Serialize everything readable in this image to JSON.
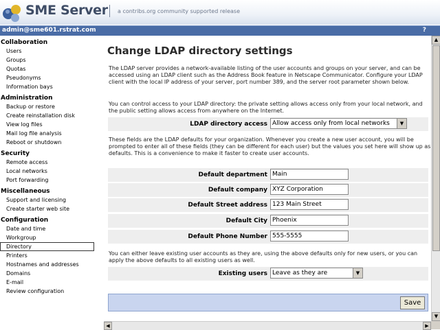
{
  "header": {
    "brand": "SME Server",
    "tagline": "a contribs.org community supported release"
  },
  "userbar": {
    "user": "admin@sme601.rstrat.com",
    "help": "?"
  },
  "sidebar": {
    "sections": [
      {
        "title": "Collaboration",
        "items": [
          "Users",
          "Groups",
          "Quotas",
          "Pseudonyms",
          "Information bays"
        ]
      },
      {
        "title": "Administration",
        "items": [
          "Backup or restore",
          "Create reinstallation disk",
          "View log files",
          "Mail log file analysis",
          "Reboot or shutdown"
        ]
      },
      {
        "title": "Security",
        "items": [
          "Remote access",
          "Local networks",
          "Port forwarding"
        ]
      },
      {
        "title": "Miscellaneous",
        "items": [
          "Support and licensing",
          "Create starter web site"
        ]
      },
      {
        "title": "Configuration",
        "items": [
          "Date and time",
          "Workgroup",
          "Directory",
          "Printers",
          "Hostnames and addresses",
          "Domains",
          "E-mail",
          "Review configuration"
        ]
      }
    ],
    "selected": "Directory"
  },
  "main": {
    "title": "Change LDAP directory settings",
    "intro": "The LDAP server provides a network-available listing of the user accounts and groups on your server, and can be accessed using an LDAP client such as the Address Book feature in Netscape Communicator. Configure your LDAP client with the local IP address of your server, port number 389, and the server root parameter shown below.",
    "access_text": "You can control access to your LDAP directory: the private setting allows access only from your local network, and the public setting allows access from anywhere on the Internet.",
    "access_label": "LDAP directory access",
    "access_value": "Allow access only from local networks",
    "defaults_text": "These fields are the LDAP defaults for your organization. Whenever you create a new user account, you will be prompted to enter all of these fields (they can be different for each user) but the values you set here will show up as defaults. This is a convenience to make it faster to create user accounts.",
    "fields": {
      "department": {
        "label": "Default department",
        "value": "Main"
      },
      "company": {
        "label": "Default company",
        "value": "XYZ Corporation"
      },
      "street": {
        "label": "Default Street address",
        "value": "123 Main Street"
      },
      "city": {
        "label": "Default City",
        "value": "Phoenix"
      },
      "phone": {
        "label": "Default Phone Number",
        "value": "555-5555"
      }
    },
    "existing_text": "You can either leave existing user accounts as they are, using the above defaults only for new users, or you can apply the above defaults to all existing users as well.",
    "existing_label": "Existing users",
    "existing_value": "Leave as they are",
    "save_label": "Save"
  },
  "colors": {
    "userbar": "#4a6ca6",
    "savebar": "#c9d5ef",
    "row": "#eeeeee"
  }
}
